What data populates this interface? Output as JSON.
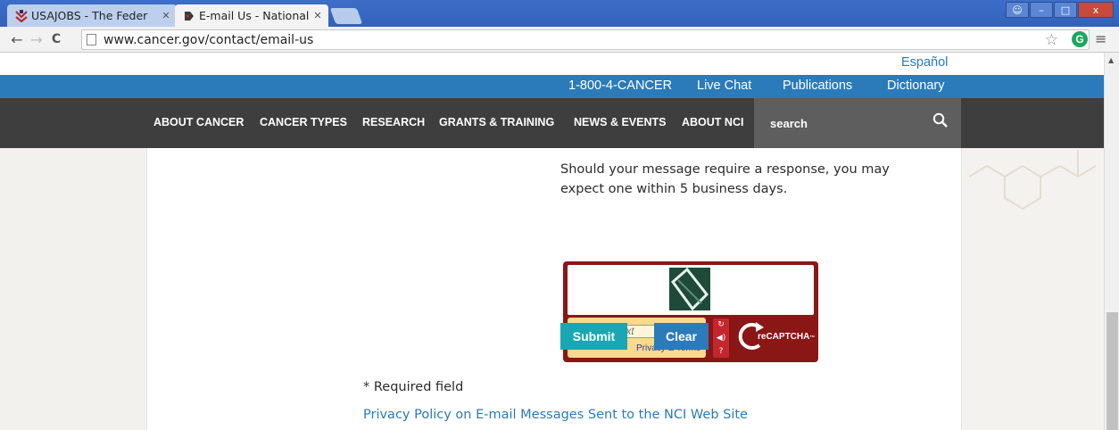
{
  "browser": {
    "tabs": [
      {
        "title": "USAJOBS - The Feder",
        "active": false
      },
      {
        "title": "E-mail Us - National I",
        "active": true
      }
    ],
    "url": "www.cancer.gov/contact/email-us",
    "window_controls": {
      "user": "☺",
      "minimize": "–",
      "maximize": "□",
      "close": "x"
    }
  },
  "site": {
    "language_link": "Español",
    "utility_nav": [
      "1-800-4-CANCER",
      "Live Chat",
      "Publications",
      "Dictionary"
    ],
    "main_nav": [
      "ABOUT CANCER",
      "CANCER TYPES",
      "RESEARCH",
      "GRANTS & TRAINING",
      "NEWS & EVENTS",
      "ABOUT NCI"
    ],
    "search_placeholder": "search"
  },
  "form": {
    "response_note": "Should your message require a response, you may expect one within 5 business days.",
    "captcha": {
      "input_placeholder": "Type the text",
      "privacy_terms": "Privacy & Terms",
      "brand": "reCAPTCHA",
      "brand_tm": "™"
    },
    "submit_label": "Submit",
    "clear_label": "Clear",
    "required_note": "* Required field",
    "privacy_link": "Privacy Policy on E-mail Messages Sent to the NCI Web Site"
  },
  "colors": {
    "brand_blue": "#2b7bba",
    "nav_dark": "#3e3e3e",
    "submit_teal": "#1aa7b3",
    "captcha_red": "#8a1616"
  }
}
